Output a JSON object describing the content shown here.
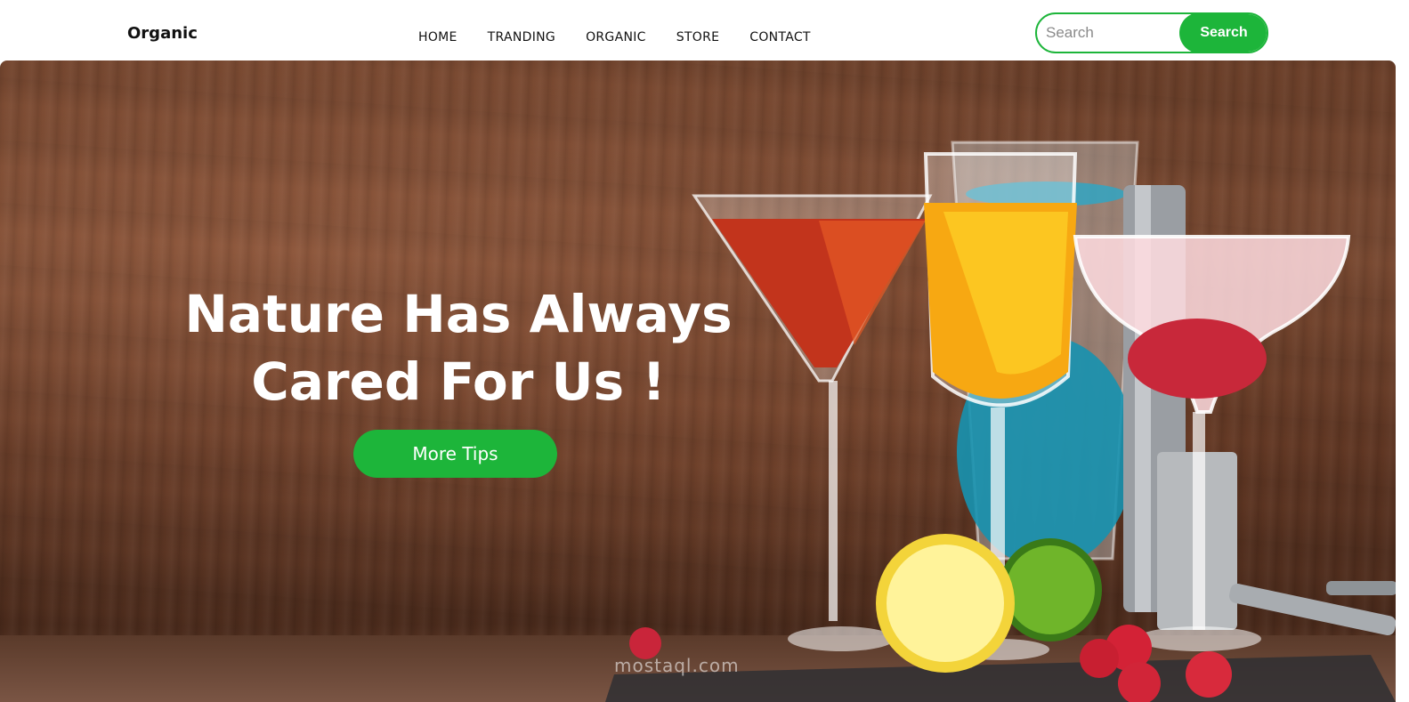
{
  "header": {
    "brand": "Organic",
    "nav": [
      {
        "label": "HOME"
      },
      {
        "label": "TRANDING"
      },
      {
        "label": "ORGANIC"
      },
      {
        "label": "STORE"
      },
      {
        "label": "CONTACT"
      }
    ],
    "search": {
      "placeholder": "Search",
      "button_label": "Search"
    }
  },
  "hero": {
    "title_line1": "Nature Has Always",
    "title_line2": "Cared For Us !",
    "cta_label": "More Tips"
  },
  "watermark": {
    "text": "mostaql.com"
  },
  "colors": {
    "accent": "#1db53a",
    "text": "#111111",
    "hero_text": "#ffffff"
  }
}
